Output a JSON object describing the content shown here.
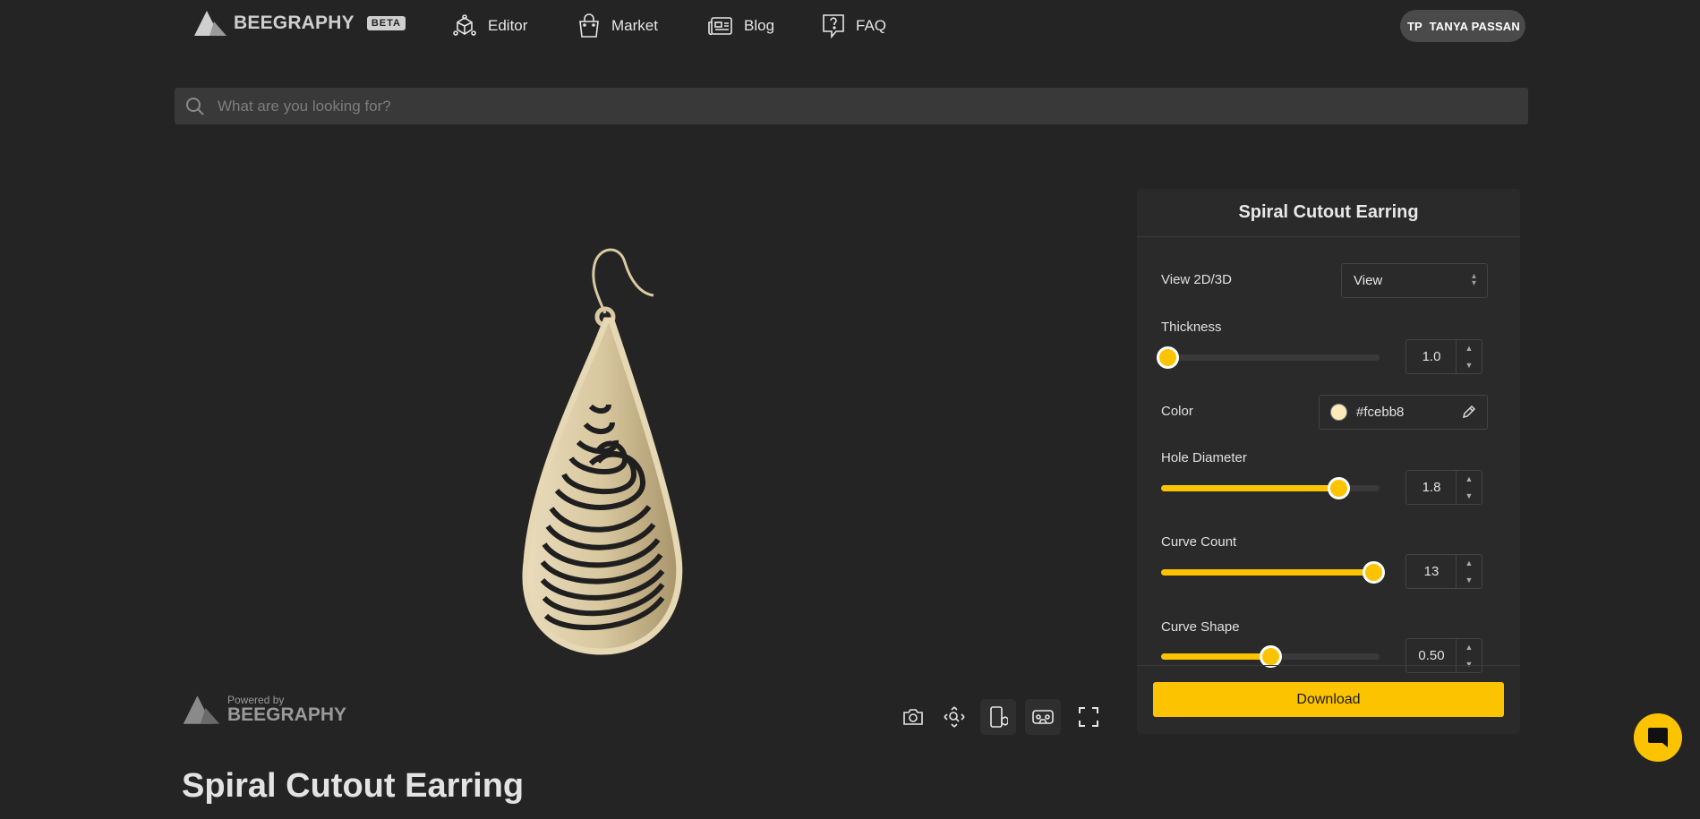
{
  "header": {
    "logo_text": "BEEGRAPHY",
    "beta_label": "BETA",
    "nav": [
      {
        "label": "Editor",
        "icon": "editor-icon"
      },
      {
        "label": "Market",
        "icon": "shopping-bag-icon"
      },
      {
        "label": "Blog",
        "icon": "newspaper-icon"
      },
      {
        "label": "FAQ",
        "icon": "question-bubble-icon"
      }
    ],
    "user": {
      "initials": "TP",
      "name": "TANYA PASSAN"
    }
  },
  "search": {
    "placeholder": "What are you looking for?"
  },
  "viewer": {
    "powered_by_small": "Powered by",
    "powered_by_big": "BEEGRAPHY",
    "tools": [
      "camera-icon",
      "focus-icon",
      "ar-icon",
      "vr-icon",
      "fullscreen-icon"
    ]
  },
  "panel": {
    "title": "Spiral Cutout Earring",
    "view": {
      "label": "View 2D/3D",
      "value": "View"
    },
    "thickness": {
      "label": "Thickness",
      "value": "1.0",
      "fraction": 0.03
    },
    "color": {
      "label": "Color",
      "value": "#fcebb8"
    },
    "hole_diameter": {
      "label": "Hole Diameter",
      "value": "1.8",
      "fraction": 0.81
    },
    "curve_count": {
      "label": "Curve Count",
      "value": "13",
      "fraction": 0.97
    },
    "curve_shape": {
      "label": "Curve Shape",
      "value": "0.50",
      "fraction": 0.5
    },
    "download_label": "Download"
  },
  "page_title": "Spiral Cutout Earring",
  "colors": {
    "accent": "#fcc400",
    "background": "#242424",
    "panel": "#2a2a2a",
    "earring": "#fcebb8"
  }
}
